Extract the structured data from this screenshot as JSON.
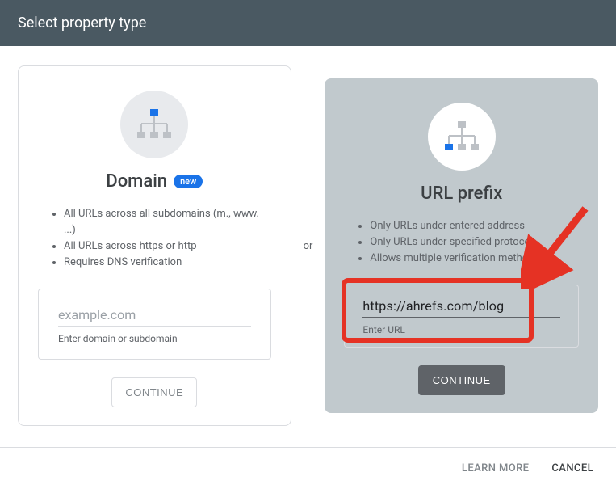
{
  "header": "Select property type",
  "orText": "or",
  "domainCard": {
    "title": "Domain",
    "badge": "new",
    "features": [
      "All URLs across all subdomains (m., www. ...)",
      "All URLs across https or http",
      "Requires DNS verification"
    ],
    "placeholder": "example.com",
    "hint": "Enter domain or subdomain",
    "button": "CONTINUE"
  },
  "urlCard": {
    "title": "URL prefix",
    "features": [
      "Only URLs under entered address",
      "Only URLs under specified protocol",
      "Allows multiple verification methods"
    ],
    "value": "https://ahrefs.com/blog",
    "hint": "Enter URL",
    "button": "CONTINUE"
  },
  "footer": {
    "learn": "LEARN MORE",
    "cancel": "CANCEL"
  }
}
